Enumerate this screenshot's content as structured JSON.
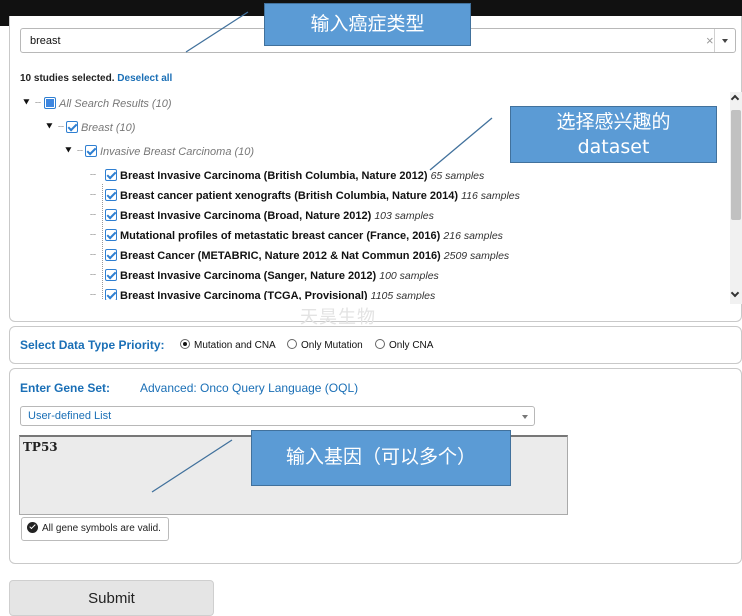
{
  "search": {
    "value": "breast",
    "clear_glyph": "×"
  },
  "selection": {
    "count_text": "10 studies selected.",
    "deselect_label": "Deselect all"
  },
  "tree": {
    "root": {
      "label": "All Search Results (10)"
    },
    "category": {
      "label": "Breast (10)"
    },
    "subcategory": {
      "label": "Invasive Breast Carcinoma (10)"
    },
    "studies": [
      {
        "name": "Breast Invasive Carcinoma (British Columbia, Nature 2012)",
        "samples": "65 samples"
      },
      {
        "name": "Breast cancer patient xenografts (British Columbia, Nature 2014)",
        "samples": "116 samples"
      },
      {
        "name": "Breast Invasive Carcinoma (Broad, Nature 2012)",
        "samples": "103 samples"
      },
      {
        "name": "Mutational profiles of metastatic breast cancer (France, 2016)",
        "samples": "216 samples"
      },
      {
        "name": "Breast Cancer (METABRIC, Nature 2012 & Nat Commun 2016)",
        "samples": "2509 samples"
      },
      {
        "name": "Breast Invasive Carcinoma (Sanger, Nature 2012)",
        "samples": "100 samples"
      },
      {
        "name": "Breast Invasive Carcinoma (TCGA, Provisional)",
        "samples": "1105 samples"
      }
    ]
  },
  "data_type": {
    "label": "Select Data Type Priority:",
    "options": [
      "Mutation and CNA",
      "Only Mutation",
      "Only CNA"
    ]
  },
  "gene_set": {
    "label": "Enter Gene Set:",
    "advanced_link": "Advanced: Onco Query Language (OQL)",
    "list_selected": "User-defined List",
    "genes": "TP53",
    "valid_message": "All gene symbols are valid."
  },
  "submit_label": "Submit",
  "watermark": "天昊生物",
  "annotations": {
    "cancer_type": "输入癌症类型",
    "dataset_line1": "选择感兴趣的",
    "dataset_line2": "dataset",
    "genes": "输入基因（可以多个）"
  },
  "colors": {
    "link_blue": "#1a6fb6",
    "callout_fill": "#5b9bd5",
    "callout_border": "#41719c"
  }
}
